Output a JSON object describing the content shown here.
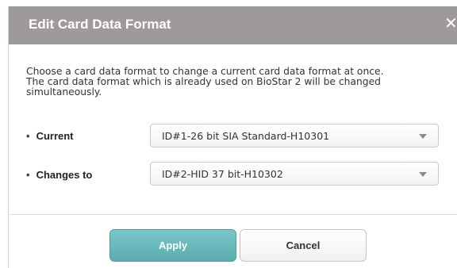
{
  "dialog": {
    "title": "Edit Card Data Format",
    "close_icon": "close-icon",
    "description_lines": [
      "Choose a card data format to change a current card data format at once.",
      "The card data format which is already used on BioStar 2 will be changed",
      "simultaneously."
    ],
    "fields": {
      "current": {
        "bullet": "•",
        "label": "Current",
        "value": "ID#1-26 bit SIA Standard-H10301"
      },
      "changes_to": {
        "bullet": "•",
        "label": "Changes to",
        "value": "ID#2-HID 37 bit-H10302"
      }
    },
    "buttons": {
      "apply": "Apply",
      "cancel": "Cancel"
    }
  },
  "colors": {
    "titlebar": "#9e9a9b",
    "apply_button": "#64b5b8",
    "cancel_button": "#f5f5f5"
  }
}
